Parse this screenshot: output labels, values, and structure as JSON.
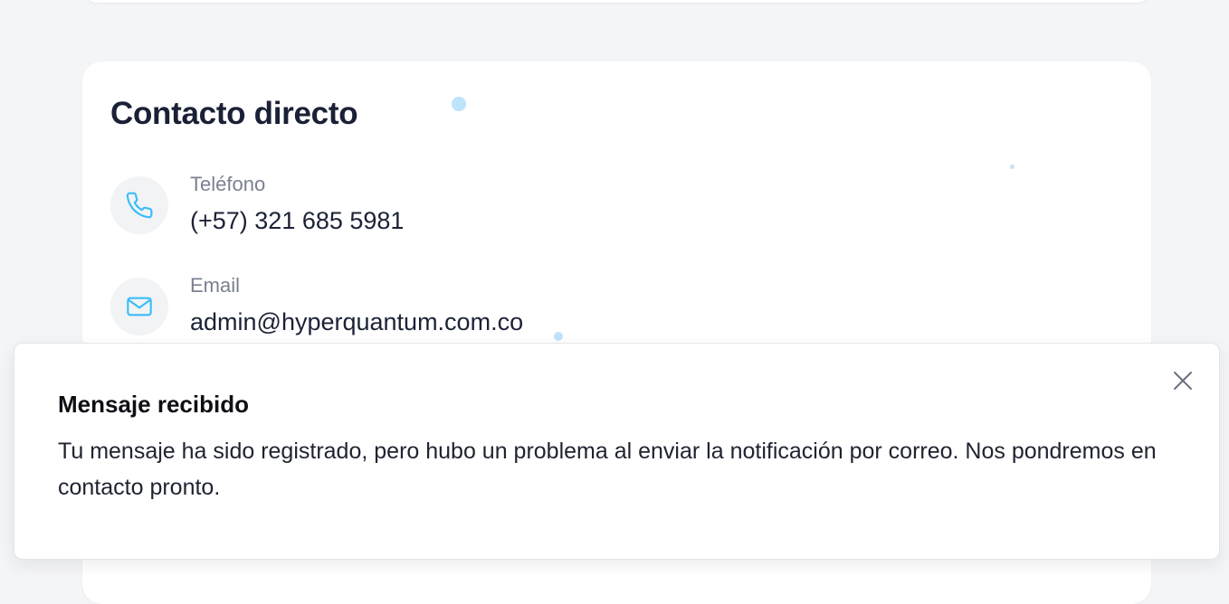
{
  "contact": {
    "title": "Contacto directo",
    "items": [
      {
        "label": "Teléfono",
        "value": "(+57) 321 685 5981",
        "icon": "phone-icon"
      },
      {
        "label": "Email",
        "value": "admin@hyperquantum.com.co",
        "icon": "mail-icon"
      }
    ]
  },
  "toast": {
    "title": "Mensaje recibido",
    "message": "Tu mensaje ha sido registrado, pero hubo un problema al enviar la notificación por correo. Nos pondremos en contacto pronto.",
    "close_icon": "close-icon"
  },
  "colors": {
    "page_background": "#f4f5f7",
    "card_background": "#ffffff",
    "icon_circle": "#f2f3f5",
    "icon_accent": "#38bdf8",
    "heading_text": "#1a2035",
    "muted_text": "#7a8090",
    "decorative_dot": "#bfe3fa"
  }
}
